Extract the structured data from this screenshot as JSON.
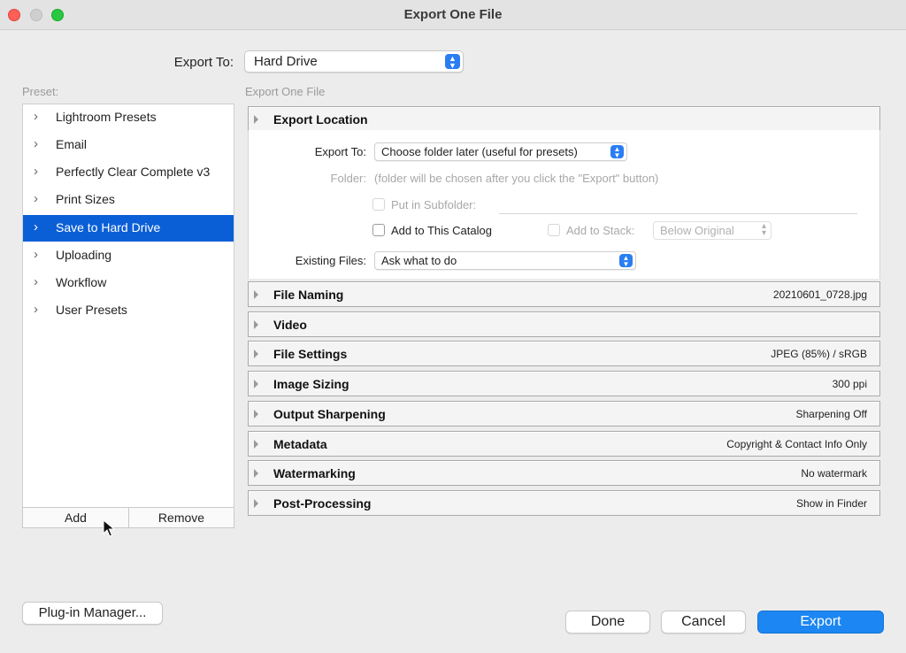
{
  "window": {
    "title": "Export One File",
    "controls": [
      "close",
      "minimize",
      "maximize"
    ]
  },
  "top": {
    "export_to_label": "Export To:",
    "export_to_value": "Hard Drive"
  },
  "presets": {
    "label": "Preset:",
    "items": [
      {
        "label": "Lightroom Presets",
        "selected": false
      },
      {
        "label": "Email",
        "selected": false
      },
      {
        "label": "Perfectly Clear Complete v3",
        "selected": false
      },
      {
        "label": "Print Sizes",
        "selected": false
      },
      {
        "label": "Save to Hard Drive",
        "selected": true
      },
      {
        "label": "Uploading",
        "selected": false
      },
      {
        "label": "Workflow",
        "selected": false
      },
      {
        "label": "User Presets",
        "selected": false
      }
    ],
    "add_label": "Add",
    "remove_label": "Remove"
  },
  "right": {
    "section_header": "Export One File",
    "export_location": {
      "title": "Export Location",
      "export_to_label": "Export To:",
      "export_to_value": "Choose folder later (useful for presets)",
      "folder_label": "Folder:",
      "folder_value": "(folder will be chosen after you click the \"Export\" button)",
      "subfolder_label": "Put in Subfolder:",
      "subfolder_checked": false,
      "add_catalog_label": "Add to This Catalog",
      "add_catalog_checked": false,
      "add_stack_label": "Add to Stack:",
      "add_stack_checked": false,
      "stack_value": "Below Original",
      "existing_files_label": "Existing Files:",
      "existing_files_value": "Ask what to do"
    },
    "sections": [
      {
        "title": "File Naming",
        "summary": "20210601_0728.jpg"
      },
      {
        "title": "Video",
        "summary": ""
      },
      {
        "title": "File Settings",
        "summary": "JPEG (85%) / sRGB"
      },
      {
        "title": "Image Sizing",
        "summary": "300 ppi"
      },
      {
        "title": "Output Sharpening",
        "summary": "Sharpening Off"
      },
      {
        "title": "Metadata",
        "summary": "Copyright & Contact Info Only"
      },
      {
        "title": "Watermarking",
        "summary": "No watermark"
      },
      {
        "title": "Post-Processing",
        "summary": "Show in Finder"
      }
    ]
  },
  "footer": {
    "plugin_manager": "Plug-in Manager...",
    "done": "Done",
    "cancel": "Cancel",
    "export": "Export"
  },
  "colors": {
    "accent": "#1c86f2",
    "selection": "#0b5fd6",
    "close": "#ff5f57",
    "maximize": "#28c840"
  }
}
